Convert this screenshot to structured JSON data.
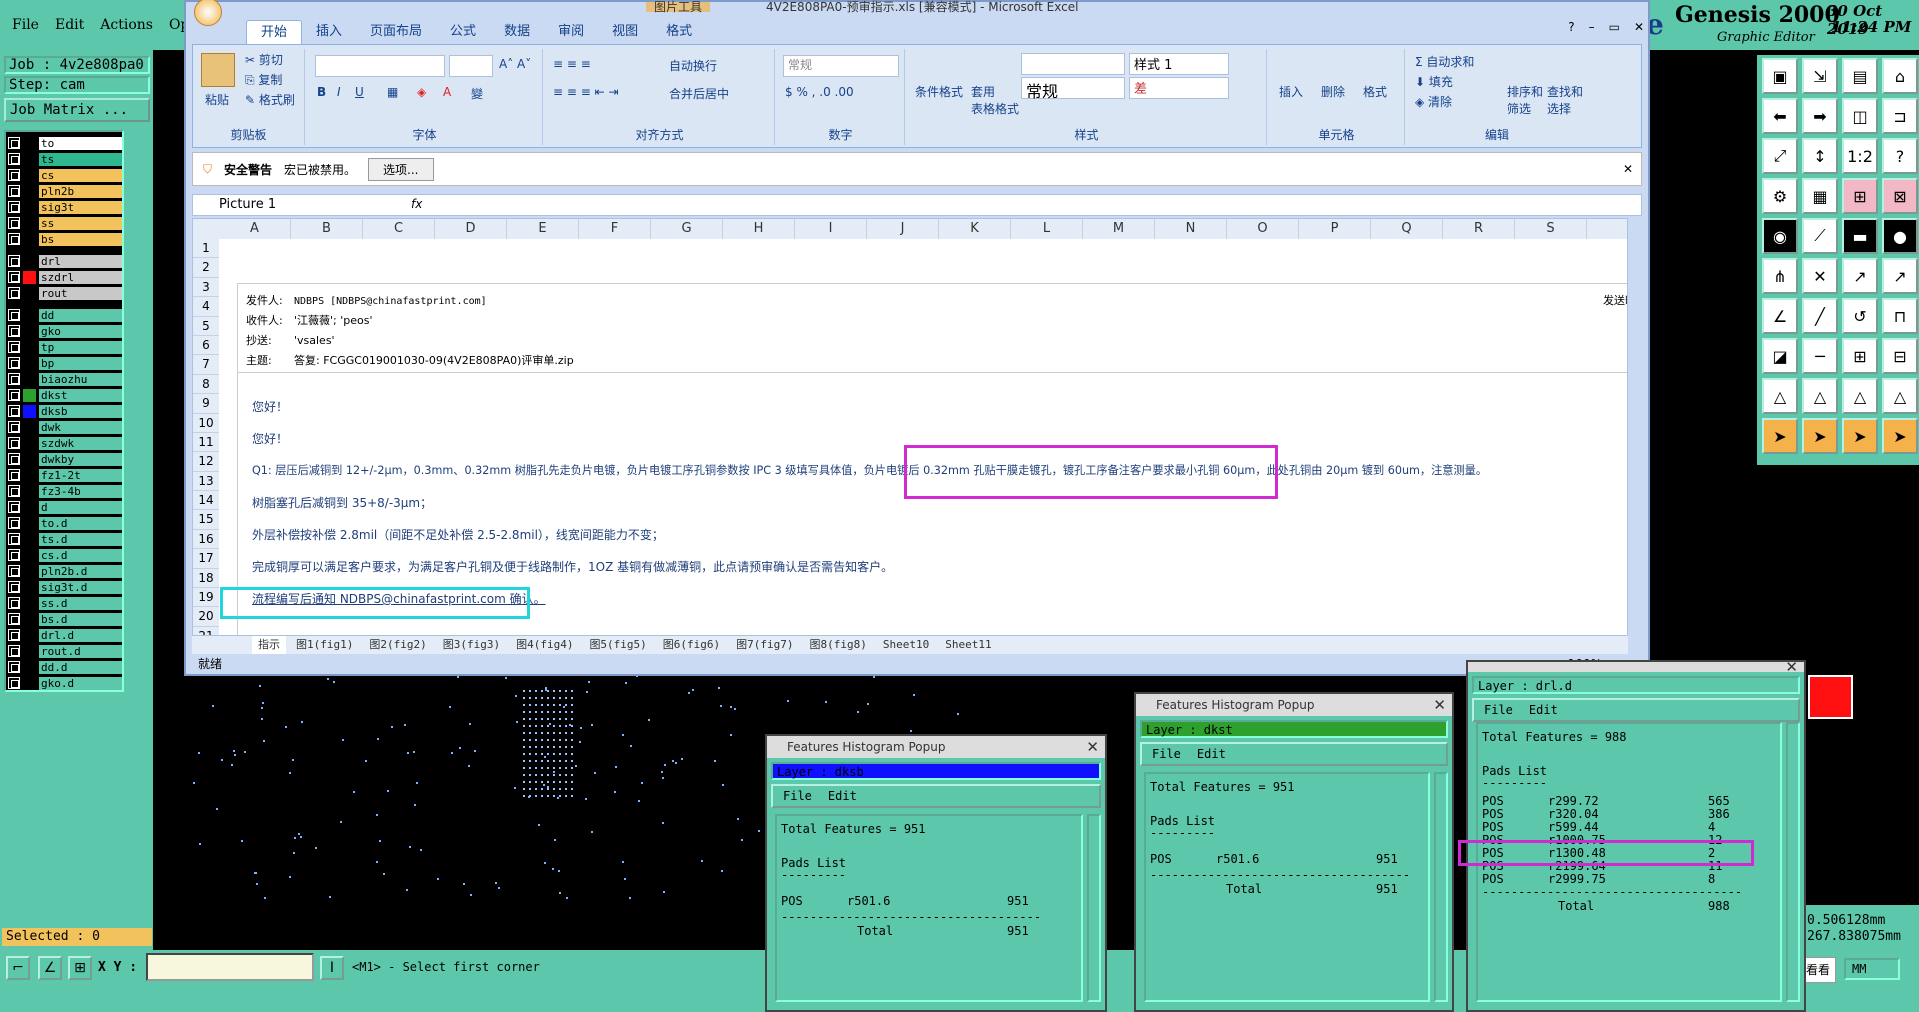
{
  "genesis": {
    "menu": [
      "File",
      "Edit",
      "Actions",
      "Opt"
    ],
    "brand": "Genesis 2000",
    "brand_sub": "Graphic Editor",
    "date": "30 Oct 2019",
    "time": "11:24 PM",
    "job": "Job : 4v2e808pa0",
    "step": "Step: cam",
    "job_matrix": "Job Matrix ...",
    "layers": [
      {
        "name": "to",
        "color": "#000000",
        "bg": "#ffffff"
      },
      {
        "name": "ts",
        "color": "#000000",
        "bg": "#2fb88f"
      },
      {
        "name": "cs",
        "color": "#000000",
        "bg": "#f2c35d"
      },
      {
        "name": "pln2b",
        "color": "#000000",
        "bg": "#f2c35d"
      },
      {
        "name": "sig3t",
        "color": "#000000",
        "bg": "#f2c35d"
      },
      {
        "name": "ss",
        "color": "#000000",
        "bg": "#f2c35d"
      },
      {
        "name": "bs",
        "color": "#000000",
        "bg": "#f2c35d"
      },
      {
        "name": "drl",
        "color": "#000000",
        "bg": "#c8c8c8"
      },
      {
        "name": "szdrl",
        "color": "#ff1010",
        "bg": "#c8c8c8"
      },
      {
        "name": "rout",
        "color": "#000000",
        "bg": "#c8c8c8"
      },
      {
        "name": "dd",
        "color": "#000000",
        "bg": "#5cc7aa"
      },
      {
        "name": "gko",
        "color": "#000000",
        "bg": "#5cc7aa"
      },
      {
        "name": "tp",
        "color": "#000000",
        "bg": "#5cc7aa"
      },
      {
        "name": "bp",
        "color": "#000000",
        "bg": "#5cc7aa"
      },
      {
        "name": "biaozhu",
        "color": "#000000",
        "bg": "#5cc7aa"
      },
      {
        "name": "dkst",
        "color": "#2ea02e",
        "bg": "#5cc7aa"
      },
      {
        "name": "dksb",
        "color": "#1010ff",
        "bg": "#5cc7aa"
      },
      {
        "name": "dwk",
        "color": "#000000",
        "bg": "#5cc7aa"
      },
      {
        "name": "szdwk",
        "color": "#000000",
        "bg": "#5cc7aa"
      },
      {
        "name": "dwkby",
        "color": "#000000",
        "bg": "#5cc7aa"
      },
      {
        "name": "fz1-2t",
        "color": "#000000",
        "bg": "#5cc7aa"
      },
      {
        "name": "fz3-4b",
        "color": "#000000",
        "bg": "#5cc7aa"
      },
      {
        "name": "d",
        "color": "#000000",
        "bg": "#5cc7aa"
      },
      {
        "name": "to.d",
        "color": "#000000",
        "bg": "#5cc7aa"
      },
      {
        "name": "ts.d",
        "color": "#000000",
        "bg": "#5cc7aa"
      },
      {
        "name": "cs.d",
        "color": "#000000",
        "bg": "#5cc7aa"
      },
      {
        "name": "pln2b.d",
        "color": "#000000",
        "bg": "#5cc7aa"
      },
      {
        "name": "sig3t.d",
        "color": "#000000",
        "bg": "#5cc7aa"
      },
      {
        "name": "ss.d",
        "color": "#000000",
        "bg": "#5cc7aa"
      },
      {
        "name": "bs.d",
        "color": "#000000",
        "bg": "#5cc7aa"
      },
      {
        "name": "drl.d",
        "color": "#000000",
        "bg": "#5cc7aa"
      },
      {
        "name": "rout.d",
        "color": "#000000",
        "bg": "#5cc7aa"
      },
      {
        "name": "dd.d",
        "color": "#000000",
        "bg": "#5cc7aa"
      },
      {
        "name": "gko.d",
        "color": "#000000",
        "bg": "#5cc7aa"
      }
    ],
    "selected": "Selected : 0",
    "xy_label": "X Y :",
    "prompt": "<M1> - Select first corner",
    "coord1": "0.506128mm",
    "coord2": "267.838075mm",
    "units": "MM",
    "popup_note": "个性设置，点我看看"
  },
  "excel": {
    "title": "4V2E808PA0-预审指示.xls [兼容模式] - Microsoft Excel",
    "context_tab": "图片工具",
    "tabs": [
      "开始",
      "插入",
      "页面布局",
      "公式",
      "数据",
      "审阅",
      "视图",
      "格式"
    ],
    "ribbon": {
      "clipboard": {
        "paste": "粘贴",
        "cut": "剪切",
        "copy": "复制",
        "format_painter": "格式刷",
        "label": "剪贴板"
      },
      "font_label": "字体",
      "align": {
        "wrap": "自动换行",
        "merge": "合并后居中",
        "label": "对齐方式"
      },
      "number": {
        "format": "常规",
        "label": "数字"
      },
      "styles": {
        "cond": "条件格式",
        "table": "套用\n表格格式",
        "normal": "常规",
        "style1": "样式 1",
        "bad": "差",
        "label": "样式"
      },
      "cells": {
        "insert": "插入",
        "delete": "删除",
        "format": "格式",
        "label": "单元格"
      },
      "edit": {
        "autosum": "自动求和",
        "fill": "填充",
        "clear": "清除",
        "sort": "排序和\n筛选",
        "find": "查找和\n选择",
        "label": "编辑"
      }
    },
    "security": {
      "warning": "安全警告",
      "message": "宏已被禁用。",
      "options": "选项..."
    },
    "name_box": "Picture 1",
    "fx": "fx",
    "columns": [
      "A",
      "B",
      "C",
      "D",
      "E",
      "F",
      "G",
      "H",
      "I",
      "J",
      "K",
      "L",
      "M",
      "N",
      "O",
      "P",
      "Q",
      "R",
      "S"
    ],
    "rows": [
      "1",
      "2",
      "3",
      "4",
      "5",
      "6",
      "7",
      "8",
      "9",
      "10",
      "11",
      "12",
      "13",
      "14",
      "15",
      "16",
      "17",
      "18",
      "19",
      "20",
      "21"
    ],
    "email": {
      "from_label": "发件人:",
      "from": "NDBPS [NDBPS@chinafastprint.com]",
      "to_label": "收件人:",
      "to": "'江薇薇'; 'peos'",
      "cc_label": "抄送:",
      "cc": "'vsales'",
      "subject_label": "主题:",
      "subject": "答复: FCGGC019001030-09(4V2E808PA0)评审单.zip",
      "sent_label": "发送时",
      "greeting1": "您好！",
      "greeting2": "您好！",
      "q1": "Q1: 层压后减铜到 12+/-2μm，0.3mm、0.32mm 树脂孔先走负片电镀，负片电镀工序孔铜参数按 IPC 3 级填写具体值，负片电镀后 0.32mm 孔贴干膜走镀孔，镀孔工序备注客户要求最小孔铜 60μm，此处孔铜由 20μm 镀到 60um，注意测量。",
      "resin": "树脂塞孔后减铜到 35+8/-3μm；",
      "comp": "外层补偿按补偿 2.8mil（间距不足处补偿 2.5-2.8mil），线宽间距能力不变；",
      "thick": "完成铜厚可以满足客户要求，为满足客户孔铜及便于线路制作，1OZ 基铜有做减薄铜，此点请预审确认是否需告知客户。",
      "flow": "流程编写后通知 NDBPS@chinafastprint.com 确认。"
    },
    "sheet_tabs": [
      "指示",
      "图1(fig1)",
      "图2(fig2)",
      "图3(fig3)",
      "图4(fig4)",
      "图5(fig5)",
      "图6(fig6)",
      "图7(fig7)",
      "图8(fig8)",
      "Sheet10",
      "Sheet11"
    ],
    "status": "就绪",
    "zoom": "100%"
  },
  "histograms": [
    {
      "title": "Features Histogram Popup",
      "layer": "Layer :  dksb",
      "layer_bg": "#1010ff",
      "menu_file": "File",
      "menu_edit": "Edit",
      "total": "Total Features = 951",
      "pads": "Pads List",
      "rows": [
        {
          "pol": "POS",
          "sym": "r501.6",
          "count": "951"
        }
      ],
      "total_label": "Total",
      "total_count": "951"
    },
    {
      "title": "Features Histogram Popup",
      "layer": "Layer :  dkst",
      "layer_bg": "#2ea02e",
      "menu_file": "File",
      "menu_edit": "Edit",
      "total": "Total Features = 951",
      "pads": "Pads List",
      "rows": [
        {
          "pol": "POS",
          "sym": "r501.6",
          "count": "951"
        }
      ],
      "total_label": "Total",
      "total_count": "951"
    },
    {
      "title": "",
      "layer": "Layer :  drl.d",
      "layer_bg": "#5cc7aa",
      "menu_file": "File",
      "menu_edit": "Edit",
      "total": "Total Features = 988",
      "pads": "Pads List",
      "rows": [
        {
          "pol": "POS",
          "sym": "r299.72",
          "count": "565"
        },
        {
          "pol": "POS",
          "sym": "r320.04",
          "count": "386"
        },
        {
          "pol": "POS",
          "sym": "r599.44",
          "count": "4"
        },
        {
          "pol": "POS",
          "sym": "r1000.75",
          "count": "12"
        },
        {
          "pol": "POS",
          "sym": "r1300.48",
          "count": "2"
        },
        {
          "pol": "POS",
          "sym": "r2199.64",
          "count": "11"
        },
        {
          "pol": "POS",
          "sym": "r2999.75",
          "count": "8"
        }
      ],
      "total_label": "Total",
      "total_count": "988"
    }
  ]
}
